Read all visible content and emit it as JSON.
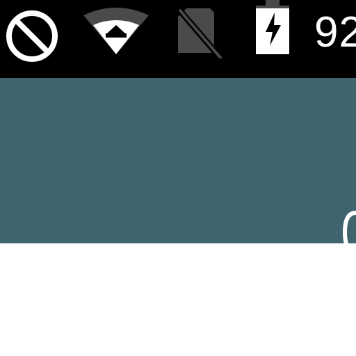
{
  "status_bar": {
    "icons": [
      {
        "name": "do-not-disturb-icon"
      },
      {
        "name": "wifi-icon"
      },
      {
        "name": "no-sim-icon"
      },
      {
        "name": "battery-charging-icon"
      }
    ],
    "battery_percent": "92"
  },
  "colors": {
    "status_bar_bg": "#000000",
    "toolbar_bg": "#3f646e",
    "content_bg": "#ffffff",
    "icon_white": "#ffffff",
    "icon_gray": "#4a4a4a"
  }
}
